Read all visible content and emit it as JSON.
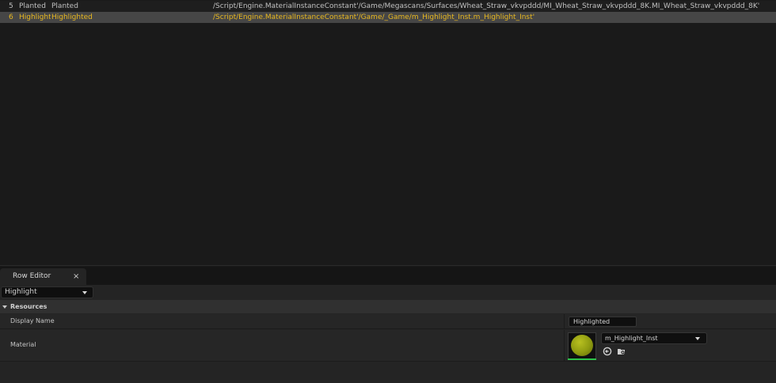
{
  "table": {
    "rows": [
      {
        "index": "5",
        "row_name": "Planted",
        "display_name": "Planted",
        "material": "/Script/Engine.MaterialInstanceConstant'/Game/Megascans/Surfaces/Wheat_Straw_vkvpddd/MI_Wheat_Straw_vkvpddd_8K.MI_Wheat_Straw_vkvpddd_8K'"
      },
      {
        "index": "6",
        "row_name": "Highlight",
        "display_name": "Highlighted",
        "material": "/Script/Engine.MaterialInstanceConstant'/Game/_Game/m_Highlight_Inst.m_Highlight_Inst'",
        "selected": true
      }
    ]
  },
  "panel": {
    "tab_label": "Row Editor",
    "tab_close": "×",
    "row_selector_value": "Highlight",
    "category": "Resources",
    "properties": {
      "display_name_label": "Display Name",
      "display_name_value": "Highlighted",
      "material_label": "Material",
      "material_asset": "m_Highlight_Inst"
    }
  },
  "icons": {
    "tab_close": "close-icon",
    "row_selector_dropdown": "chevron-down-icon",
    "category_toggle": "triangle-down-icon",
    "asset_dropdown": "chevron-down-icon",
    "use_selected": "arrow-left-circle-icon",
    "browse_asset": "folder-search-icon"
  },
  "colors": {
    "selected_row_text": "#e8b820",
    "material_sphere": "#a0aa18",
    "thumbnail_accent": "#2ec24a"
  }
}
